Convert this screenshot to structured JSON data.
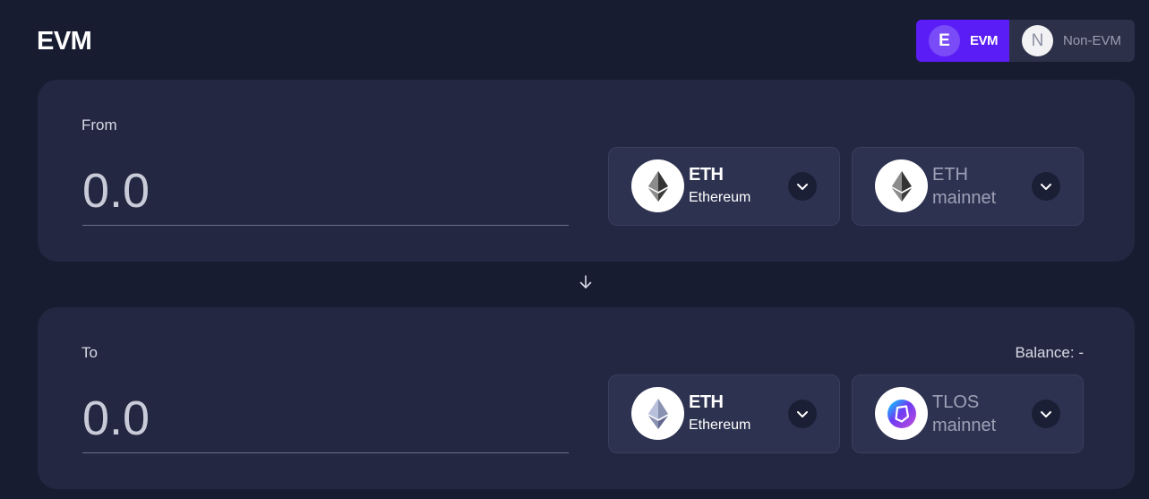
{
  "header": {
    "title": "EVM"
  },
  "toggle": {
    "evm": {
      "badge": "E",
      "label": "EVM"
    },
    "non_evm": {
      "badge": "N",
      "label": "Non-EVM"
    }
  },
  "from": {
    "label": "From",
    "amount_placeholder": "0.0",
    "token": {
      "symbol": "ETH",
      "name": "Ethereum",
      "icon": "ethereum-icon"
    },
    "network": {
      "name": "ETH",
      "sub": "mainnet",
      "icon": "ethereum-icon"
    }
  },
  "to": {
    "label": "To",
    "balance": "Balance: -",
    "amount_placeholder": "0.0",
    "token": {
      "symbol": "ETH",
      "name": "Ethereum",
      "icon": "ethereum-icon"
    },
    "network": {
      "name": "TLOS",
      "sub": "mainnet",
      "icon": "telos-icon"
    }
  },
  "colors": {
    "background": "#181c31",
    "card": "#232741",
    "accent": "#5b1df5",
    "selector": "#2d3250"
  }
}
